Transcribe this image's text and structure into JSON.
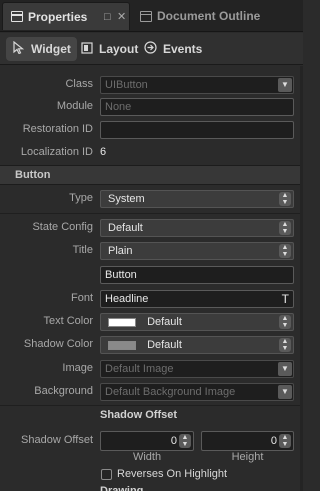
{
  "tabs": {
    "properties": "Properties",
    "document_outline": "Document Outline",
    "minimize_glyph": "□",
    "close_glyph": "✕"
  },
  "subtabs": {
    "widget": "Widget",
    "layout": "Layout",
    "events": "Events"
  },
  "general": {
    "class_label": "Class",
    "class_value": "UIButton",
    "module_label": "Module",
    "module_value": "None",
    "restoration_label": "Restoration ID",
    "restoration_value": "",
    "localization_label": "Localization ID",
    "localization_value": "6"
  },
  "button_section": {
    "header": "Button",
    "type_label": "Type",
    "type_value": "System",
    "state_label": "State Config",
    "state_value": "Default",
    "title_label": "Title",
    "title_value": "Plain",
    "title_text": "Button",
    "font_label": "Font",
    "font_value": "Headline",
    "font_glyph": "T",
    "text_color_label": "Text Color",
    "text_color_value": "Default",
    "text_color_swatch": "#ffffff",
    "shadow_color_label": "Shadow Color",
    "shadow_color_value": "Default",
    "shadow_color_swatch": "#8a8a8a",
    "image_label": "Image",
    "image_value": "Default Image",
    "background_label": "Background",
    "background_value": "Default Background Image"
  },
  "shadow": {
    "header": "Shadow Offset",
    "label": "Shadow Offset",
    "width_value": "0",
    "height_value": "0",
    "width_label": "Width",
    "height_label": "Height",
    "reverses_label": "Reverses On Highlight",
    "next_section_cut": "Drawing"
  }
}
